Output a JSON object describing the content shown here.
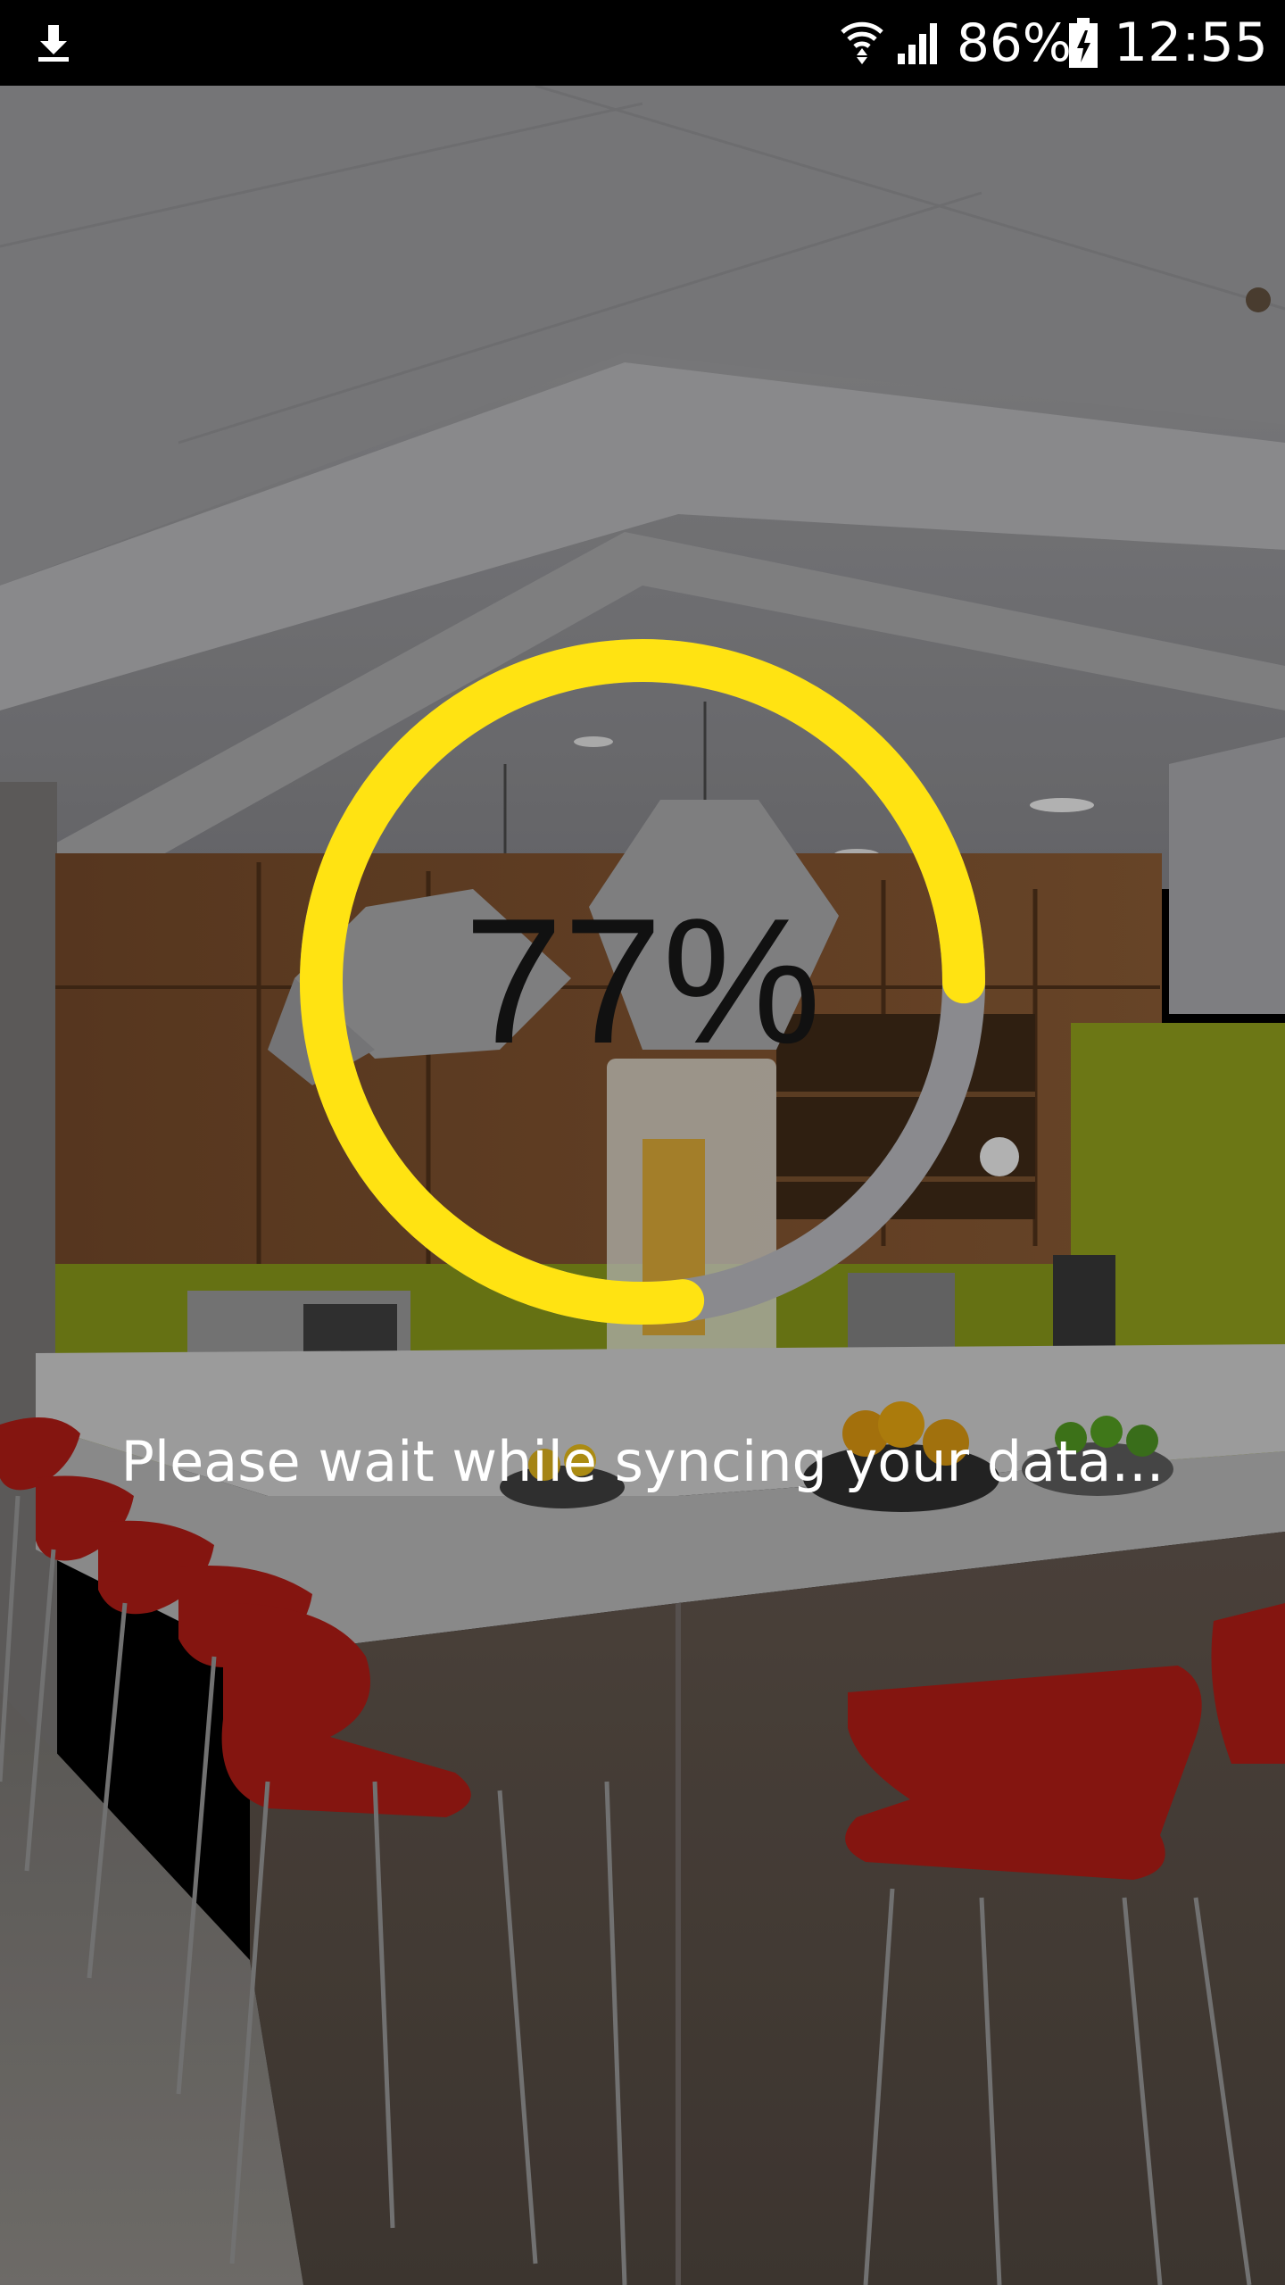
{
  "status_bar": {
    "battery_percent": "86%",
    "time": "12:55",
    "icons": [
      "download-icon",
      "wifi-icon",
      "signal-icon",
      "battery-charging-icon"
    ]
  },
  "progress": {
    "label": "77%",
    "value": 0.77,
    "ring_color": "#FFE312",
    "track_color": "#8A8A8E"
  },
  "message": "Please wait while syncing your data..."
}
